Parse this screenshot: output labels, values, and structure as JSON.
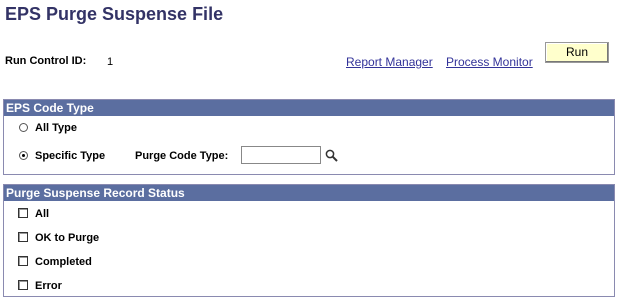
{
  "page": {
    "title": "EPS Purge Suspense File"
  },
  "run_control": {
    "label": "Run Control ID:",
    "value": "1"
  },
  "links": {
    "report_manager": "Report Manager",
    "process_monitor": "Process Monitor"
  },
  "run_button": "Run",
  "eps_code_type": {
    "header": "EPS Code Type",
    "options": [
      {
        "label": "All Type",
        "selected": false
      },
      {
        "label": "Specific Type",
        "selected": true
      }
    ],
    "purge_code_type_label": "Purge Code Type:",
    "purge_code_type_value": ""
  },
  "record_status": {
    "header": "Purge Suspense Record Status",
    "items": [
      {
        "label": "All",
        "checked": false
      },
      {
        "label": "OK to Purge",
        "checked": false
      },
      {
        "label": "Completed",
        "checked": false
      },
      {
        "label": "Error",
        "checked": false
      }
    ]
  },
  "icons": {
    "lookup": "magnifying-glass-icon"
  },
  "colors": {
    "title": "#333366",
    "panel_header": "#5b6ea0",
    "run_button_bg": "#ffffcc",
    "link": "#333399"
  }
}
